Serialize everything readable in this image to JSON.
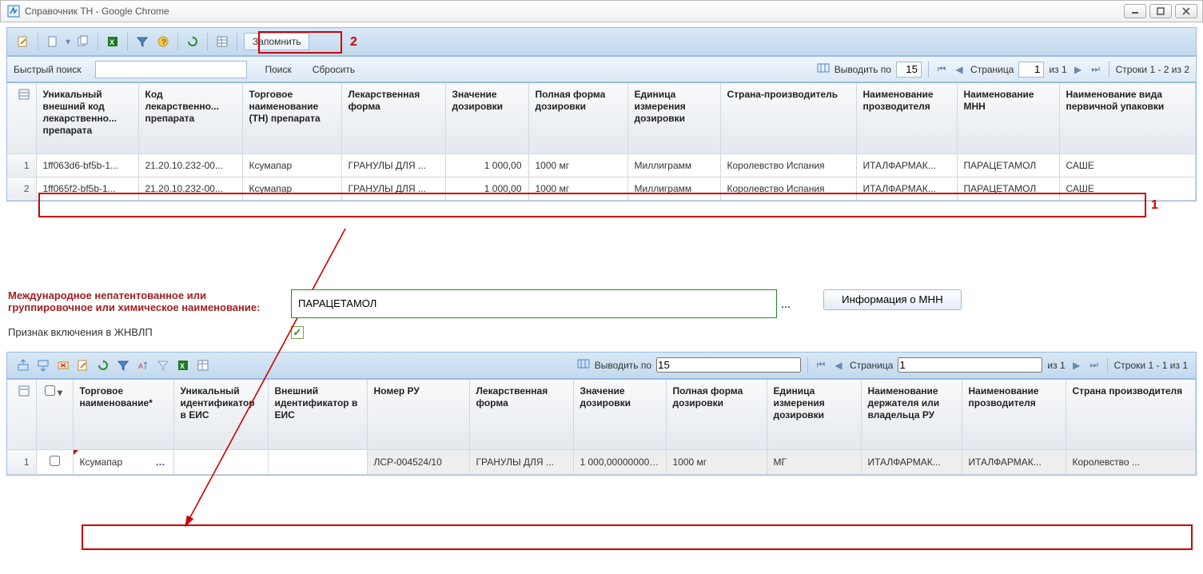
{
  "window": {
    "title": "Справочник ТН - Google Chrome"
  },
  "toolbar1": {
    "remember": "Запомнить"
  },
  "annotations": {
    "num1": "1",
    "num2": "2"
  },
  "search": {
    "label": "Быстрый поиск",
    "search_btn": "Поиск",
    "reset_btn": "Сбросить"
  },
  "pager": {
    "per_page_lbl": "Выводить по",
    "per_page_val": "15",
    "page_lbl": "Страница",
    "page_val": "1",
    "of_pages": "из 1",
    "rows_info_top": "Строки 1 - 2 из 2",
    "rows_info_bottom": "Строки 1 - 1 из 1"
  },
  "grid1": {
    "headers": {
      "c1": "Уникальный внешний код лекарственно... препарата",
      "c2": "Код лекарственно... препарата",
      "c3": "Торговое наименование (ТН) препарата",
      "c4": "Лекарственная форма",
      "c5": "Значение дозировки",
      "c6": "Полная форма дозировки",
      "c7": "Единица измерения дозировки",
      "c8": "Страна-производитель",
      "c9": "Наименование прозводителя",
      "c10": "Наименование МНН",
      "c11": "Наименование вида первичной упаковки"
    },
    "rows": [
      {
        "n": "1",
        "c1": "1ff063d6-bf5b-1...",
        "c2": "21.20.10.232-00...",
        "c3": "Ксумапар",
        "c4": "ГРАНУЛЫ ДЛЯ ...",
        "c5": "1 000,00",
        "c6": "1000 мг",
        "c7": "Миллиграмм",
        "c8": "Королевство Испания",
        "c9": "ИТАЛФАРМАК...",
        "c10": "ПАРАЦЕТАМОЛ",
        "c11": "САШЕ"
      },
      {
        "n": "2",
        "c1": "1ff065f2-bf5b-1...",
        "c2": "21.20.10.232-00...",
        "c3": "Ксумапар",
        "c4": "ГРАНУЛЫ ДЛЯ ...",
        "c5": "1 000,00",
        "c6": "1000 мг",
        "c7": "Миллиграмм",
        "c8": "Королевство Испания",
        "c9": "ИТАЛФАРМАК...",
        "c10": "ПАРАЦЕТАМОЛ",
        "c11": "САШЕ"
      }
    ]
  },
  "form": {
    "mnn_label": "Международное непатентованное или группировочное или химическое наименование:",
    "mnn_value": "ПАРАЦЕТАМОЛ",
    "info_btn": "Информация о МНН",
    "zhvnlp_label": "Признак включения в ЖНВЛП"
  },
  "grid2": {
    "headers": {
      "c1": "Торговое наименование*",
      "c2": "Уникальный идентификатор в ЕИС",
      "c3": "Внешний идентификатор в ЕИС",
      "c4": "Номер РУ",
      "c5": "Лекарственная форма",
      "c6": "Значение дозировки",
      "c7": "Полная форма дозировки",
      "c8": "Единица измерения дозировки",
      "c9": "Наименование держателя или владельца РУ",
      "c10": "Наименование прозводителя",
      "c11": "Страна производителя"
    },
    "row": {
      "n": "1",
      "c1": "Ксумапар",
      "c4": "ЛСР-004524/10",
      "c5": "ГРАНУЛЫ ДЛЯ ...",
      "c6": "1 000,0000000000",
      "c7": "1000 мг",
      "c8": "МГ",
      "c9": "ИТАЛФАРМАК...",
      "c10": "ИТАЛФАРМАК...",
      "c11": "Королевство ..."
    }
  }
}
